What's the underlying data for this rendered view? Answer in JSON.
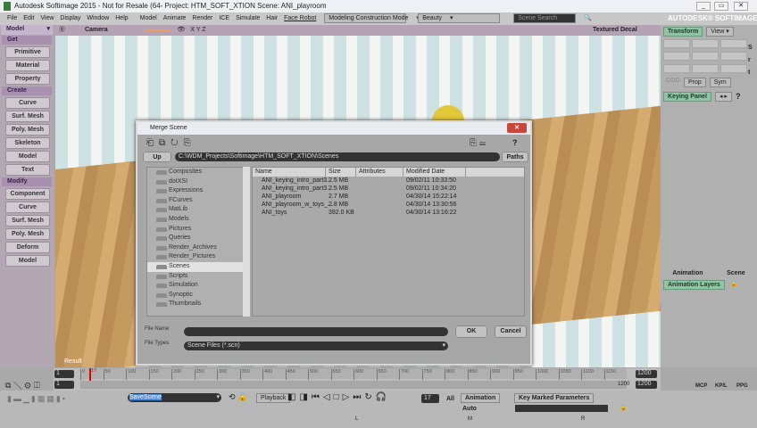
{
  "title": "Autodesk Softimage 2015  - Not for Resale (64-       Project: HTM_SOFT_XTION     Scene: ANI_playroom",
  "menu": [
    "File",
    "Edit",
    "View",
    "Display",
    "Window",
    "Help",
    "Model",
    "Animate",
    "Render",
    "ICE",
    "Simulate",
    "Hair",
    "Face Robot"
  ],
  "mode": "Modeling Construction Mode",
  "render_preset": "Beauty",
  "scene_search": "Scene Search",
  "brand": "AUTODESK® SOFTIMAGE®",
  "viewport": {
    "camera": "Camera",
    "axes": "X Y Z",
    "display": "Textured Decal",
    "label": "Result"
  },
  "sidebar": {
    "mode": "Model",
    "sections": [
      {
        "title": "Get",
        "items": [
          "Primitive",
          "Material",
          "Property"
        ]
      },
      {
        "title": "Create",
        "items": [
          "Curve",
          "Surf. Mesh",
          "Poly. Mesh",
          "Skeleton",
          "Model",
          "Text"
        ]
      },
      {
        "title": "Modify",
        "items": [
          "Component",
          "Curve",
          "Surf. Mesh",
          "Poly. Mesh",
          "Deform",
          "Model"
        ]
      }
    ]
  },
  "right": {
    "transform": "Transform",
    "view": "View",
    "s": "S",
    "r": "r",
    "t": "t",
    "cog": "COG",
    "prop": "Prop",
    "sym": "Sym",
    "keying": "Keying Panel",
    "help": "?",
    "tab_anim": "Animation",
    "tab_scene": "Scene",
    "anim_layers": "Animation Layers"
  },
  "dialog": {
    "title": "Merge Scene",
    "up": "Up",
    "path": "C:\\WDM_Projects\\Softimage\\HTM_SOFT_XTION\\Scenes",
    "paths": "Paths",
    "help": "?",
    "folders": [
      "Composites",
      "dotXSI",
      "Expressions",
      "FCurves",
      "MatLib",
      "Models",
      "Pictures",
      "Queries",
      "Render_Archives",
      "Render_Pictures",
      "Scenes",
      "Scripts",
      "Simulation",
      "Synoptic",
      "Thumbnails"
    ],
    "selected_folder": "Scenes",
    "columns": [
      "Name",
      "Size",
      "Attributes",
      "Modified Date"
    ],
    "files": [
      [
        "ANI_keying_intro_part3...",
        "2.5 MB",
        "",
        "09/02/11 10:33:50"
      ],
      [
        "ANI_keying_intro_part3...",
        "2.5 MB",
        "",
        "09/02/11 10:34:20"
      ],
      [
        "ANI_playroom",
        "2.7 MB",
        "",
        "04/30/14 15:22:14"
      ],
      [
        "ANI_playroom_w_toys_...",
        "2.8 MB",
        "",
        "04/30/14 13:30:56"
      ],
      [
        "ANI_toys",
        "392.0 KB",
        "",
        "04/30/14 13:16:22"
      ]
    ],
    "file_name_label": "File Name",
    "file_name": "",
    "file_types_label": "File Types",
    "file_type": "Scene Files (*.scn)",
    "ok": "OK",
    "cancel": "Cancel"
  },
  "timeline": {
    "start": "1",
    "start2": "1",
    "current": "17",
    "end": "1200",
    "end2": "1200",
    "end3": "1200",
    "ticks": [
      "0",
      "50",
      "100",
      "150",
      "200",
      "250",
      "300",
      "350",
      "400",
      "450",
      "500",
      "550",
      "600",
      "650",
      "700",
      "750",
      "800",
      "850",
      "900",
      "950",
      "1000",
      "1050",
      "1100",
      "1150"
    ]
  },
  "bottom": {
    "command": "SaveScene",
    "playback": "Playback",
    "frame": "17",
    "all": "All",
    "animation": "Animation",
    "auto": "Auto",
    "key_marked": "Key Marked Parameters",
    "mcp": "MCP",
    "kpl": "KP/L",
    "ppg": "PPG",
    "m": "M",
    "r": "R",
    "l": "L"
  }
}
